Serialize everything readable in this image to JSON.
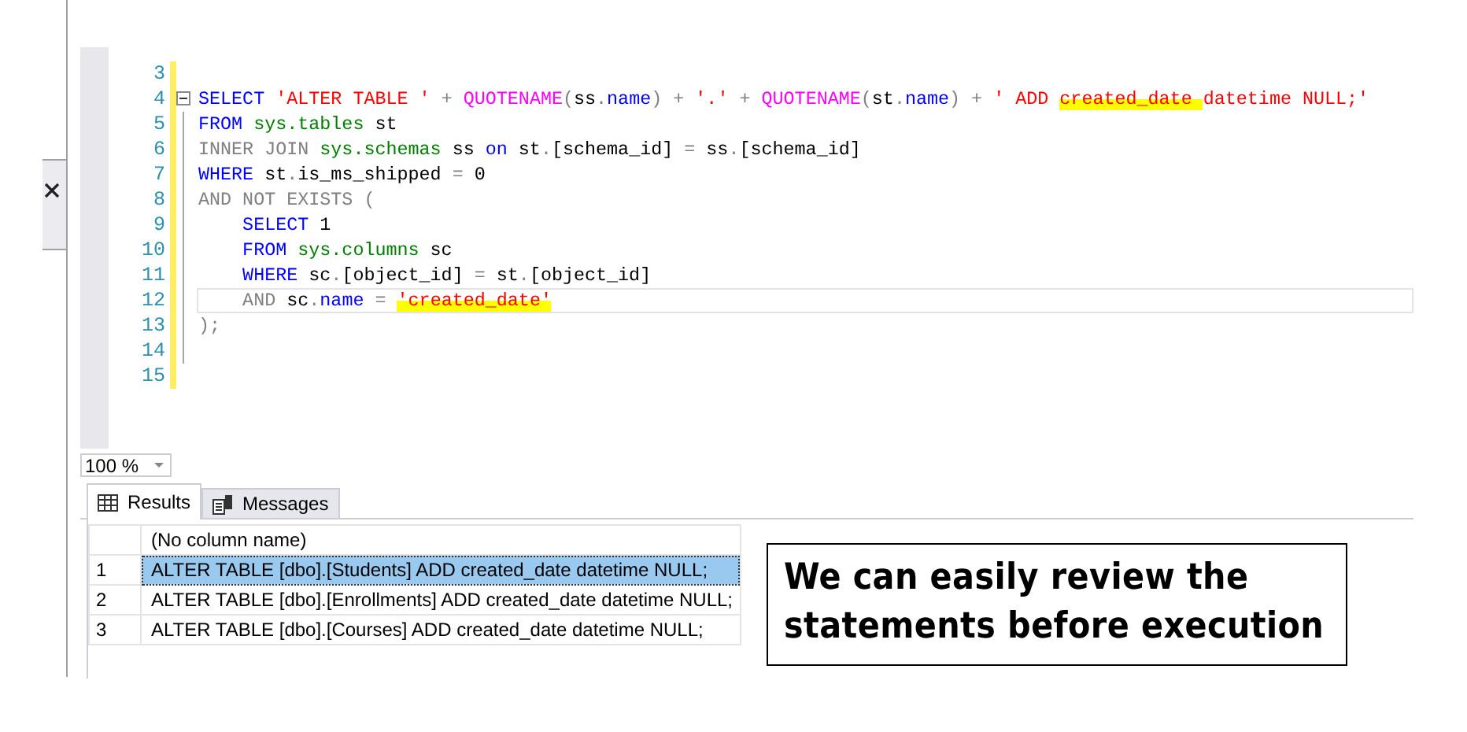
{
  "editor": {
    "lines": [
      {
        "number": "3",
        "current": false,
        "fold": false
      },
      {
        "number": "4",
        "current": false,
        "fold": true,
        "tokens": [
          {
            "t": "SELECT",
            "color": "#0000ff"
          },
          {
            "t": " 'ALTER TABLE '",
            "color": "#ff0000"
          },
          {
            "t": " + ",
            "color": "#808080"
          },
          {
            "t": "QUOTENAME",
            "color": "#ff00ff"
          },
          {
            "t": "(",
            "color": "#808080"
          },
          {
            "t": "ss",
            "color": "#000000"
          },
          {
            "t": ".",
            "color": "#808080"
          },
          {
            "t": "name",
            "color": "#0000ff"
          },
          {
            "t": ")",
            "color": "#808080"
          },
          {
            "t": " + ",
            "color": "#808080"
          },
          {
            "t": "'.'",
            "color": "#ff0000"
          },
          {
            "t": " + ",
            "color": "#808080"
          },
          {
            "t": "QUOTENAME",
            "color": "#ff00ff"
          },
          {
            "t": "(",
            "color": "#808080"
          },
          {
            "t": "st",
            "color": "#000000"
          },
          {
            "t": ".",
            "color": "#808080"
          },
          {
            "t": "name",
            "color": "#0000ff"
          },
          {
            "t": ")",
            "color": "#808080"
          },
          {
            "t": " + ",
            "color": "#808080"
          },
          {
            "t": "' ADD ",
            "color": "#ff0000"
          },
          {
            "t": "created_date ",
            "color": "#ff0000",
            "hl": true
          },
          {
            "t": "datetime NULL;'",
            "color": "#ff0000"
          }
        ]
      },
      {
        "number": "5",
        "current": false,
        "fold": false,
        "tokens": [
          {
            "t": "FROM",
            "color": "#0000ff"
          },
          {
            "t": " sys.tables",
            "color": "#008000"
          },
          {
            "t": " st",
            "color": "#000000"
          }
        ]
      },
      {
        "number": "6",
        "current": false,
        "fold": false,
        "tokens": [
          {
            "t": "INNER JOIN",
            "color": "#808080"
          },
          {
            "t": " sys.schemas",
            "color": "#008000"
          },
          {
            "t": " ss ",
            "color": "#000000"
          },
          {
            "t": "on",
            "color": "#0000ff"
          },
          {
            "t": " st",
            "color": "#000000"
          },
          {
            "t": ".",
            "color": "#808080"
          },
          {
            "t": "[schema_id]",
            "color": "#000000"
          },
          {
            "t": " = ",
            "color": "#808080"
          },
          {
            "t": "ss",
            "color": "#000000"
          },
          {
            "t": ".",
            "color": "#808080"
          },
          {
            "t": "[schema_id]",
            "color": "#000000"
          }
        ]
      },
      {
        "number": "7",
        "current": false,
        "fold": false,
        "tokens": [
          {
            "t": "WHERE",
            "color": "#0000ff"
          },
          {
            "t": " st",
            "color": "#000000"
          },
          {
            "t": ".",
            "color": "#808080"
          },
          {
            "t": "is_ms_shipped",
            "color": "#000000"
          },
          {
            "t": " = ",
            "color": "#808080"
          },
          {
            "t": "0",
            "color": "#000000"
          }
        ]
      },
      {
        "number": "8",
        "current": false,
        "fold": false,
        "tokens": [
          {
            "t": "AND NOT EXISTS (",
            "color": "#808080"
          }
        ]
      },
      {
        "number": "9",
        "current": false,
        "fold": false,
        "tokens": [
          {
            "t": "    SELECT",
            "color": "#0000ff"
          },
          {
            "t": " 1",
            "color": "#000000"
          }
        ]
      },
      {
        "number": "10",
        "current": false,
        "fold": false,
        "tokens": [
          {
            "t": "    FROM",
            "color": "#0000ff"
          },
          {
            "t": " sys.columns",
            "color": "#008000"
          },
          {
            "t": " sc",
            "color": "#000000"
          }
        ]
      },
      {
        "number": "11",
        "current": false,
        "fold": false,
        "tokens": [
          {
            "t": "    WHERE",
            "color": "#0000ff"
          },
          {
            "t": " sc",
            "color": "#000000"
          },
          {
            "t": ".",
            "color": "#808080"
          },
          {
            "t": "[object_id]",
            "color": "#000000"
          },
          {
            "t": " = ",
            "color": "#808080"
          },
          {
            "t": "st",
            "color": "#000000"
          },
          {
            "t": ".",
            "color": "#808080"
          },
          {
            "t": "[object_id]",
            "color": "#000000"
          }
        ]
      },
      {
        "number": "12",
        "current": true,
        "fold": false,
        "tokens": [
          {
            "t": "    AND",
            "color": "#808080"
          },
          {
            "t": " sc",
            "color": "#000000"
          },
          {
            "t": ".",
            "color": "#808080"
          },
          {
            "t": "name",
            "color": "#0000ff"
          },
          {
            "t": " = ",
            "color": "#808080"
          },
          {
            "t": "'created_date'",
            "color": "#ff0000",
            "hl": true
          }
        ]
      },
      {
        "number": "13",
        "current": false,
        "fold": false,
        "tokens": [
          {
            "t": ");",
            "color": "#808080"
          }
        ]
      },
      {
        "number": "14",
        "current": false,
        "fold": false
      },
      {
        "number": "15",
        "current": false,
        "fold": false
      }
    ]
  },
  "zoom": {
    "value": "100 %"
  },
  "tabs": [
    {
      "label": "Results",
      "kind": "grid",
      "selected": true
    },
    {
      "label": "Messages",
      "kind": "messages",
      "selected": false
    }
  ],
  "results": {
    "columns": [
      "(No column name)"
    ],
    "rows": [
      {
        "number": "1",
        "cells": [
          "ALTER TABLE [dbo].[Students] ADD created_date datetime NULL;"
        ],
        "selected": true
      },
      {
        "number": "2",
        "cells": [
          "ALTER TABLE [dbo].[Enrollments] ADD created_date datetime NULL;"
        ],
        "selected": false
      },
      {
        "number": "3",
        "cells": [
          "ALTER TABLE [dbo].[Courses] ADD created_date datetime NULL;"
        ],
        "selected": false
      }
    ]
  },
  "note": {
    "text": "We can easily review the statements before execution"
  }
}
